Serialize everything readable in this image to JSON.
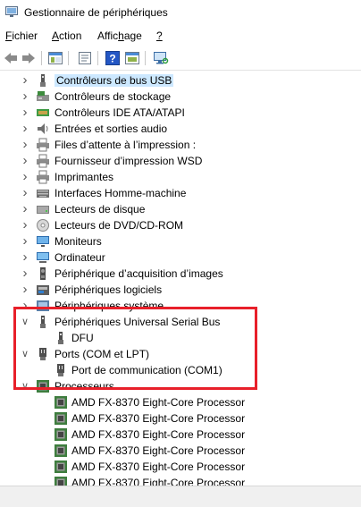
{
  "window": {
    "title": "Gestionnaire de périphériques"
  },
  "menu": [
    "Fichier",
    "Action",
    "Affichage",
    "?"
  ],
  "toolbar": [
    "back-icon",
    "forward-icon",
    "show-hide-icon",
    "properties-icon",
    "help-icon",
    "update-driver-icon",
    "scan-hardware-icon"
  ],
  "tree": [
    {
      "label": "Contrôleurs de bus USB",
      "icon": "usb-icon",
      "state": "collapsed"
    },
    {
      "label": "Contrôleurs de stockage",
      "icon": "storage-icon",
      "state": "collapsed"
    },
    {
      "label": "Contrôleurs IDE ATA/ATAPI",
      "icon": "ide-icon",
      "state": "collapsed"
    },
    {
      "label": "Entrées et sorties audio",
      "icon": "speaker-icon",
      "state": "collapsed"
    },
    {
      "label": "Files d’attente à l’impression :",
      "icon": "printer-icon",
      "state": "collapsed"
    },
    {
      "label": "Fournisseur d’impression WSD",
      "icon": "printer-icon",
      "state": "collapsed"
    },
    {
      "label": "Imprimantes",
      "icon": "printer-icon",
      "state": "collapsed"
    },
    {
      "label": "Interfaces Homme-machine",
      "icon": "keyboard-icon",
      "state": "collapsed"
    },
    {
      "label": "Lecteurs de disque",
      "icon": "disk-icon",
      "state": "collapsed"
    },
    {
      "label": "Lecteurs de DVD/CD-ROM",
      "icon": "dvd-icon",
      "state": "collapsed"
    },
    {
      "label": "Moniteurs",
      "icon": "monitor-icon",
      "state": "collapsed"
    },
    {
      "label": "Ordinateur",
      "icon": "computer-icon",
      "state": "collapsed"
    },
    {
      "label": "Périphérique d’acquisition d’images",
      "icon": "camera-icon",
      "state": "collapsed"
    },
    {
      "label": "Périphériques logiciels",
      "icon": "software-device-icon",
      "state": "collapsed"
    },
    {
      "label": "Périphériques système",
      "icon": "system-icon",
      "state": "collapsed"
    },
    {
      "label": "Périphériques Universal Serial Bus",
      "icon": "usb-plug-icon",
      "state": "expanded"
    },
    {
      "label": "DFU",
      "icon": "usb-plug-icon",
      "state": "child"
    },
    {
      "label": "Ports (COM et LPT)",
      "icon": "port-icon",
      "state": "expanded"
    },
    {
      "label": "Port de communication (COM1)",
      "icon": "port-icon",
      "state": "child"
    },
    {
      "label": "Processeurs",
      "icon": "cpu-icon",
      "state": "expanded"
    },
    {
      "label": "AMD FX-8370 Eight-Core Processor",
      "icon": "cpu-icon",
      "state": "child"
    },
    {
      "label": "AMD FX-8370 Eight-Core Processor",
      "icon": "cpu-icon",
      "state": "child"
    },
    {
      "label": "AMD FX-8370 Eight-Core Processor",
      "icon": "cpu-icon",
      "state": "child"
    },
    {
      "label": "AMD FX-8370 Eight-Core Processor",
      "icon": "cpu-icon",
      "state": "child"
    },
    {
      "label": "AMD FX-8370 Eight-Core Processor",
      "icon": "cpu-icon",
      "state": "child"
    },
    {
      "label": "AMD FX-8370 Eight-Core Processor",
      "icon": "cpu-icon",
      "state": "child"
    }
  ],
  "colors": {
    "annotation": "#e8202a",
    "selection": "#cce8ff"
  }
}
